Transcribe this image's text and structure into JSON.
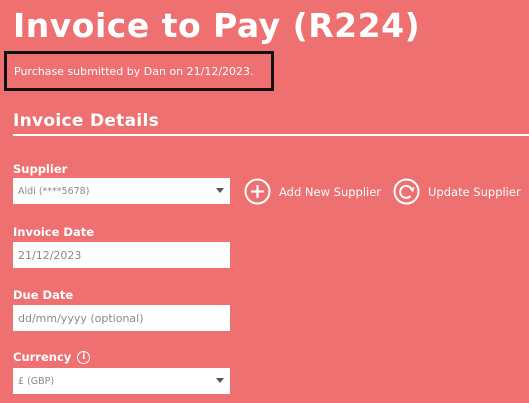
{
  "header": {
    "title": "Invoice to Pay (R224)",
    "submitted_note": "Purchase submitted by Dan on 21/12/2023."
  },
  "section": {
    "title": "Invoice Details"
  },
  "supplier": {
    "label": "Supplier",
    "selected": "Aldi (****5678)",
    "add_label": "Add New Supplier",
    "update_label": "Update Supplier"
  },
  "invoice_date": {
    "label": "Invoice Date",
    "value": "21/12/2023"
  },
  "due_date": {
    "label": "Due Date",
    "value": "",
    "placeholder": "dd/mm/yyyy (optional)"
  },
  "currency": {
    "label": "Currency",
    "info_glyph": "i",
    "selected": "£ (GBP)"
  },
  "icons": {
    "add": "plus-circle-icon",
    "update": "refresh-circle-icon",
    "info": "info-circle-icon",
    "dropdown": "chevron-down-icon"
  },
  "colors": {
    "background": "#ee7071",
    "text": "#ffffff",
    "highlight_border": "#111111"
  }
}
